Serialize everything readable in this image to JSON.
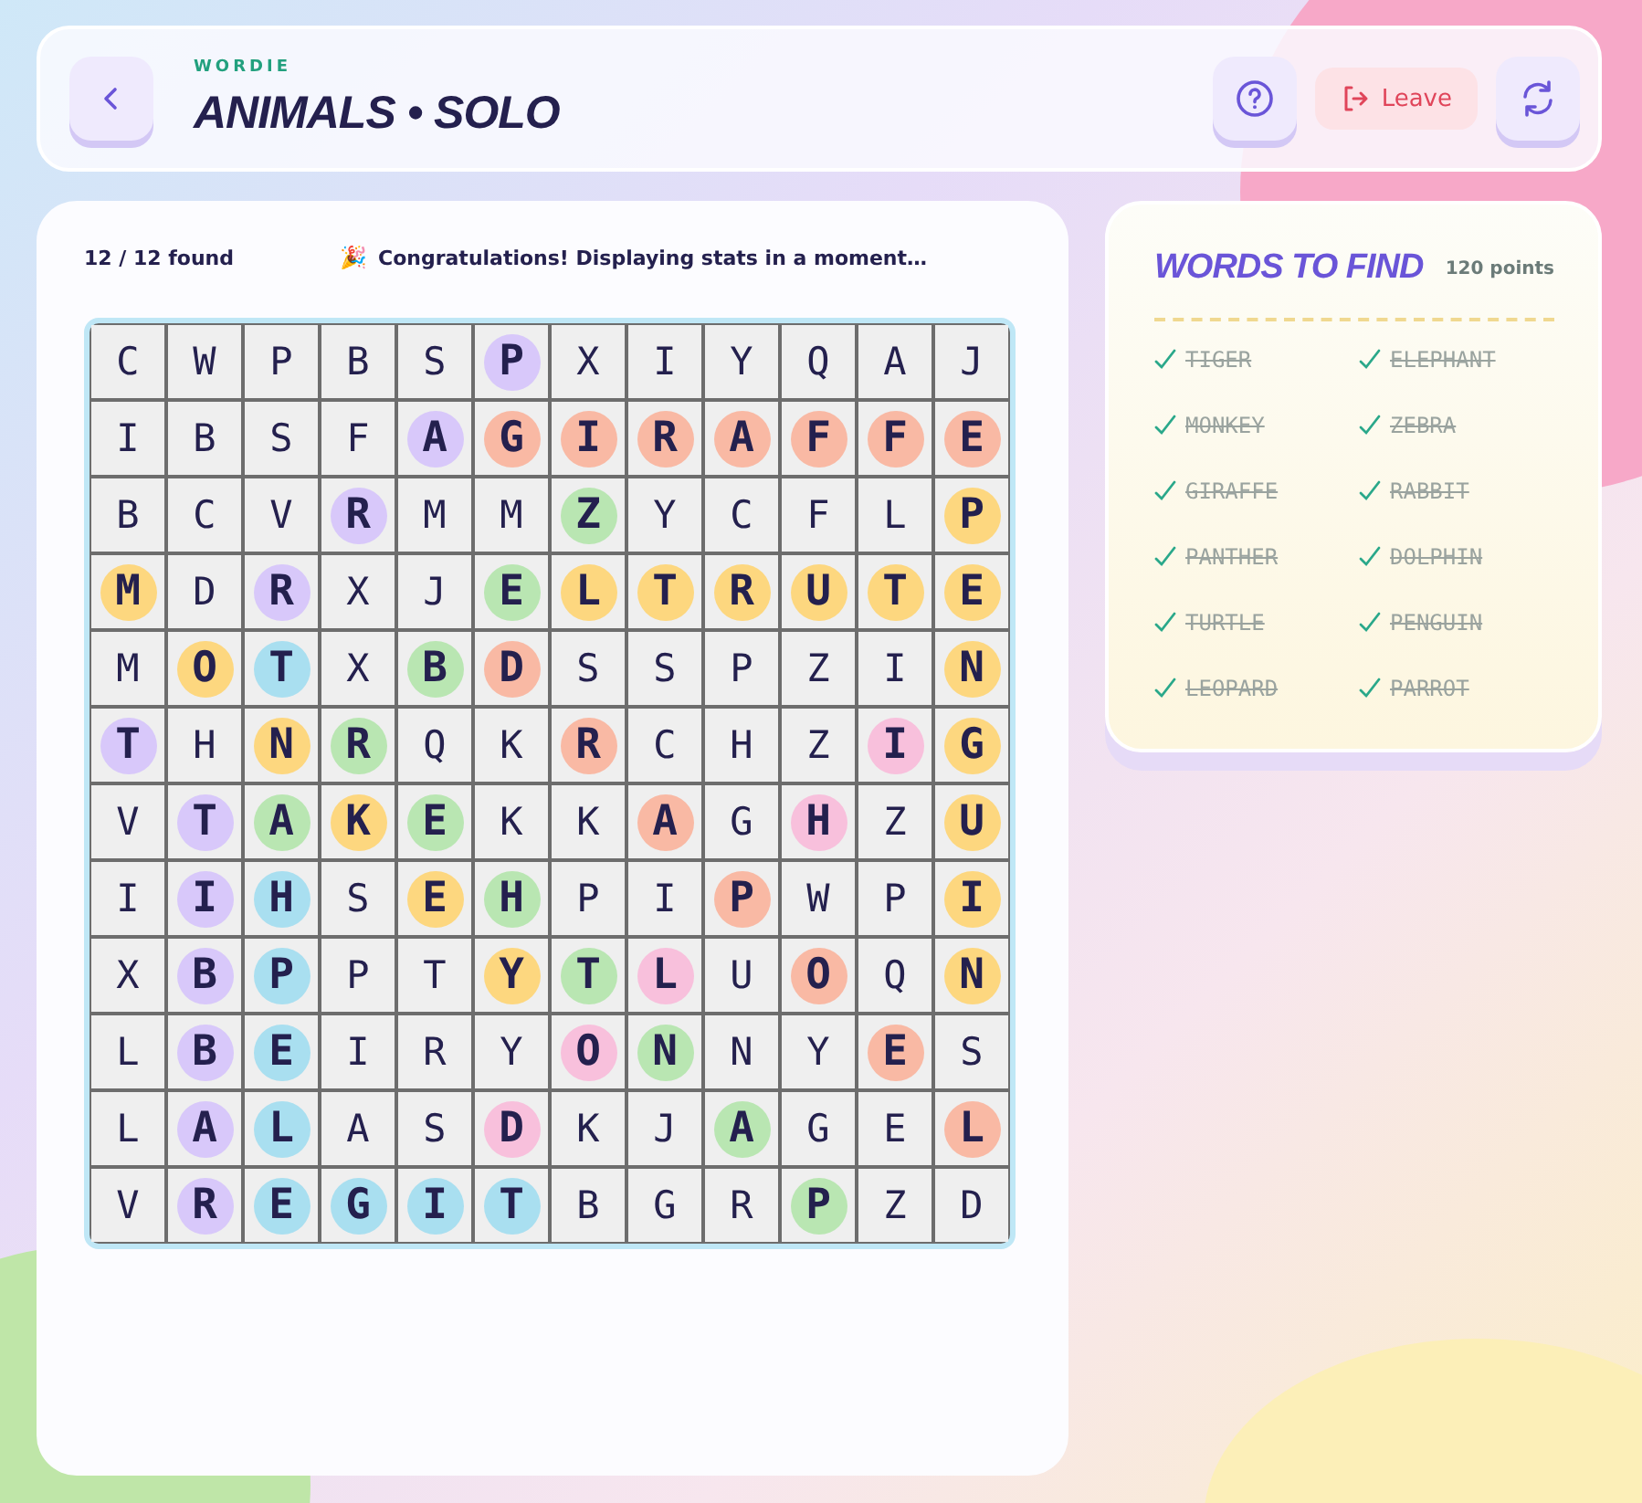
{
  "header": {
    "brand": "WORDIE",
    "title": "ANIMALS • SOLO",
    "leave_label": "Leave"
  },
  "board": {
    "progress": "12 / 12 found",
    "message_icon": "🎉",
    "message": "Congratulations! Displaying stats in a moment…",
    "rows": [
      [
        {
          "letter": "C"
        },
        {
          "letter": "W"
        },
        {
          "letter": "P"
        },
        {
          "letter": "B"
        },
        {
          "letter": "S"
        },
        {
          "letter": "P",
          "color": "#d8c8fa"
        },
        {
          "letter": "X"
        },
        {
          "letter": "I"
        },
        {
          "letter": "Y"
        },
        {
          "letter": "Q"
        },
        {
          "letter": "A"
        },
        {
          "letter": "J"
        }
      ],
      [
        {
          "letter": "I"
        },
        {
          "letter": "B"
        },
        {
          "letter": "S"
        },
        {
          "letter": "F"
        },
        {
          "letter": "A",
          "color": "#d8c8fa"
        },
        {
          "letter": "G",
          "color": "#f9b9a4"
        },
        {
          "letter": "I",
          "color": "#f9b9a4"
        },
        {
          "letter": "R",
          "color": "#f9b9a4"
        },
        {
          "letter": "A",
          "color": "#f9b9a4"
        },
        {
          "letter": "F",
          "color": "#f9b9a4"
        },
        {
          "letter": "F",
          "color": "#f9b9a4"
        },
        {
          "letter": "E",
          "color": "#f9b9a4"
        }
      ],
      [
        {
          "letter": "B"
        },
        {
          "letter": "C"
        },
        {
          "letter": "V"
        },
        {
          "letter": "R",
          "color": "#d8c8fa"
        },
        {
          "letter": "M"
        },
        {
          "letter": "M"
        },
        {
          "letter": "Z",
          "color": "#b9e6b2"
        },
        {
          "letter": "Y"
        },
        {
          "letter": "C"
        },
        {
          "letter": "F"
        },
        {
          "letter": "L"
        },
        {
          "letter": "P",
          "color": "#fdd77f"
        }
      ],
      [
        {
          "letter": "M",
          "color": "#fdd77f"
        },
        {
          "letter": "D"
        },
        {
          "letter": "R",
          "color": "#d8c8fa"
        },
        {
          "letter": "X"
        },
        {
          "letter": "J"
        },
        {
          "letter": "E",
          "color": "#b9e6b2"
        },
        {
          "letter": "L",
          "color": "#fdd77f"
        },
        {
          "letter": "T",
          "color": "#fdd77f"
        },
        {
          "letter": "R",
          "color": "#fdd77f"
        },
        {
          "letter": "U",
          "color": "#fdd77f"
        },
        {
          "letter": "T",
          "color": "#fdd77f"
        },
        {
          "letter": "E",
          "color": "#fdd77f"
        }
      ],
      [
        {
          "letter": "M"
        },
        {
          "letter": "O",
          "color": "#fdd77f"
        },
        {
          "letter": "T",
          "color": "#a9dff0"
        },
        {
          "letter": "X"
        },
        {
          "letter": "B",
          "color": "#b9e6b2"
        },
        {
          "letter": "D",
          "color": "#f9b9a4"
        },
        {
          "letter": "S"
        },
        {
          "letter": "S"
        },
        {
          "letter": "P"
        },
        {
          "letter": "Z"
        },
        {
          "letter": "I"
        },
        {
          "letter": "N",
          "color": "#fdd77f"
        }
      ],
      [
        {
          "letter": "T",
          "color": "#d8c8fa"
        },
        {
          "letter": "H"
        },
        {
          "letter": "N",
          "color": "#fdd77f"
        },
        {
          "letter": "R",
          "color": "#b9e6b2"
        },
        {
          "letter": "Q"
        },
        {
          "letter": "K"
        },
        {
          "letter": "R",
          "color": "#f9b9a4"
        },
        {
          "letter": "C"
        },
        {
          "letter": "H"
        },
        {
          "letter": "Z"
        },
        {
          "letter": "I",
          "color": "#f8c0dc"
        },
        {
          "letter": "G",
          "color": "#fdd77f"
        }
      ],
      [
        {
          "letter": "V"
        },
        {
          "letter": "T",
          "color": "#d8c8fa"
        },
        {
          "letter": "A",
          "color": "#b9e6b2"
        },
        {
          "letter": "K",
          "color": "#fdd77f"
        },
        {
          "letter": "E",
          "color": "#b9e6b2"
        },
        {
          "letter": "K"
        },
        {
          "letter": "K"
        },
        {
          "letter": "A",
          "color": "#f9b9a4"
        },
        {
          "letter": "G"
        },
        {
          "letter": "H",
          "color": "#f8c0dc"
        },
        {
          "letter": "Z"
        },
        {
          "letter": "U",
          "color": "#fdd77f"
        }
      ],
      [
        {
          "letter": "I"
        },
        {
          "letter": "I",
          "color": "#d8c8fa"
        },
        {
          "letter": "H",
          "color": "#a9dff0"
        },
        {
          "letter": "S"
        },
        {
          "letter": "E",
          "color": "#fdd77f"
        },
        {
          "letter": "H",
          "color": "#b9e6b2"
        },
        {
          "letter": "P"
        },
        {
          "letter": "I"
        },
        {
          "letter": "P",
          "color": "#f9b9a4"
        },
        {
          "letter": "W"
        },
        {
          "letter": "P"
        },
        {
          "letter": "I",
          "color": "#fdd77f"
        }
      ],
      [
        {
          "letter": "X"
        },
        {
          "letter": "B",
          "color": "#d8c8fa"
        },
        {
          "letter": "P",
          "color": "#a9dff0"
        },
        {
          "letter": "P"
        },
        {
          "letter": "T"
        },
        {
          "letter": "Y",
          "color": "#fdd77f"
        },
        {
          "letter": "T",
          "color": "#b9e6b2"
        },
        {
          "letter": "L",
          "color": "#f8c0dc"
        },
        {
          "letter": "U"
        },
        {
          "letter": "O",
          "color": "#f9b9a4"
        },
        {
          "letter": "Q"
        },
        {
          "letter": "N",
          "color": "#fdd77f"
        }
      ],
      [
        {
          "letter": "L"
        },
        {
          "letter": "B",
          "color": "#d8c8fa"
        },
        {
          "letter": "E",
          "color": "#a9dff0"
        },
        {
          "letter": "I"
        },
        {
          "letter": "R"
        },
        {
          "letter": "Y"
        },
        {
          "letter": "O",
          "color": "#f8c0dc"
        },
        {
          "letter": "N",
          "color": "#b9e6b2"
        },
        {
          "letter": "N"
        },
        {
          "letter": "Y"
        },
        {
          "letter": "E",
          "color": "#f9b9a4"
        },
        {
          "letter": "S"
        }
      ],
      [
        {
          "letter": "L"
        },
        {
          "letter": "A",
          "color": "#d8c8fa"
        },
        {
          "letter": "L",
          "color": "#a9dff0"
        },
        {
          "letter": "A"
        },
        {
          "letter": "S"
        },
        {
          "letter": "D",
          "color": "#f8c0dc"
        },
        {
          "letter": "K"
        },
        {
          "letter": "J"
        },
        {
          "letter": "A",
          "color": "#b9e6b2"
        },
        {
          "letter": "G"
        },
        {
          "letter": "E"
        },
        {
          "letter": "L",
          "color": "#f9b9a4"
        }
      ],
      [
        {
          "letter": "V"
        },
        {
          "letter": "R",
          "color": "#d8c8fa"
        },
        {
          "letter": "E",
          "color": "#a9dff0"
        },
        {
          "letter": "G",
          "color": "#a9dff0"
        },
        {
          "letter": "I",
          "color": "#a9dff0"
        },
        {
          "letter": "T",
          "color": "#a9dff0"
        },
        {
          "letter": "B"
        },
        {
          "letter": "G"
        },
        {
          "letter": "R"
        },
        {
          "letter": "P",
          "color": "#b9e6b2"
        },
        {
          "letter": "Z"
        },
        {
          "letter": "D"
        }
      ]
    ]
  },
  "word_list": {
    "title": "WORDS TO FIND",
    "points": "120 points",
    "words": [
      {
        "word": "TIGER",
        "found": true
      },
      {
        "word": "ELEPHANT",
        "found": true
      },
      {
        "word": "MONKEY",
        "found": true
      },
      {
        "word": "ZEBRA",
        "found": true
      },
      {
        "word": "GIRAFFE",
        "found": true
      },
      {
        "word": "RABBIT",
        "found": true
      },
      {
        "word": "PANTHER",
        "found": true
      },
      {
        "word": "DOLPHIN",
        "found": true
      },
      {
        "word": "TURTLE",
        "found": true
      },
      {
        "word": "PENGUIN",
        "found": true
      },
      {
        "word": "LEOPARD",
        "found": true
      },
      {
        "word": "PARROT",
        "found": true
      }
    ]
  }
}
